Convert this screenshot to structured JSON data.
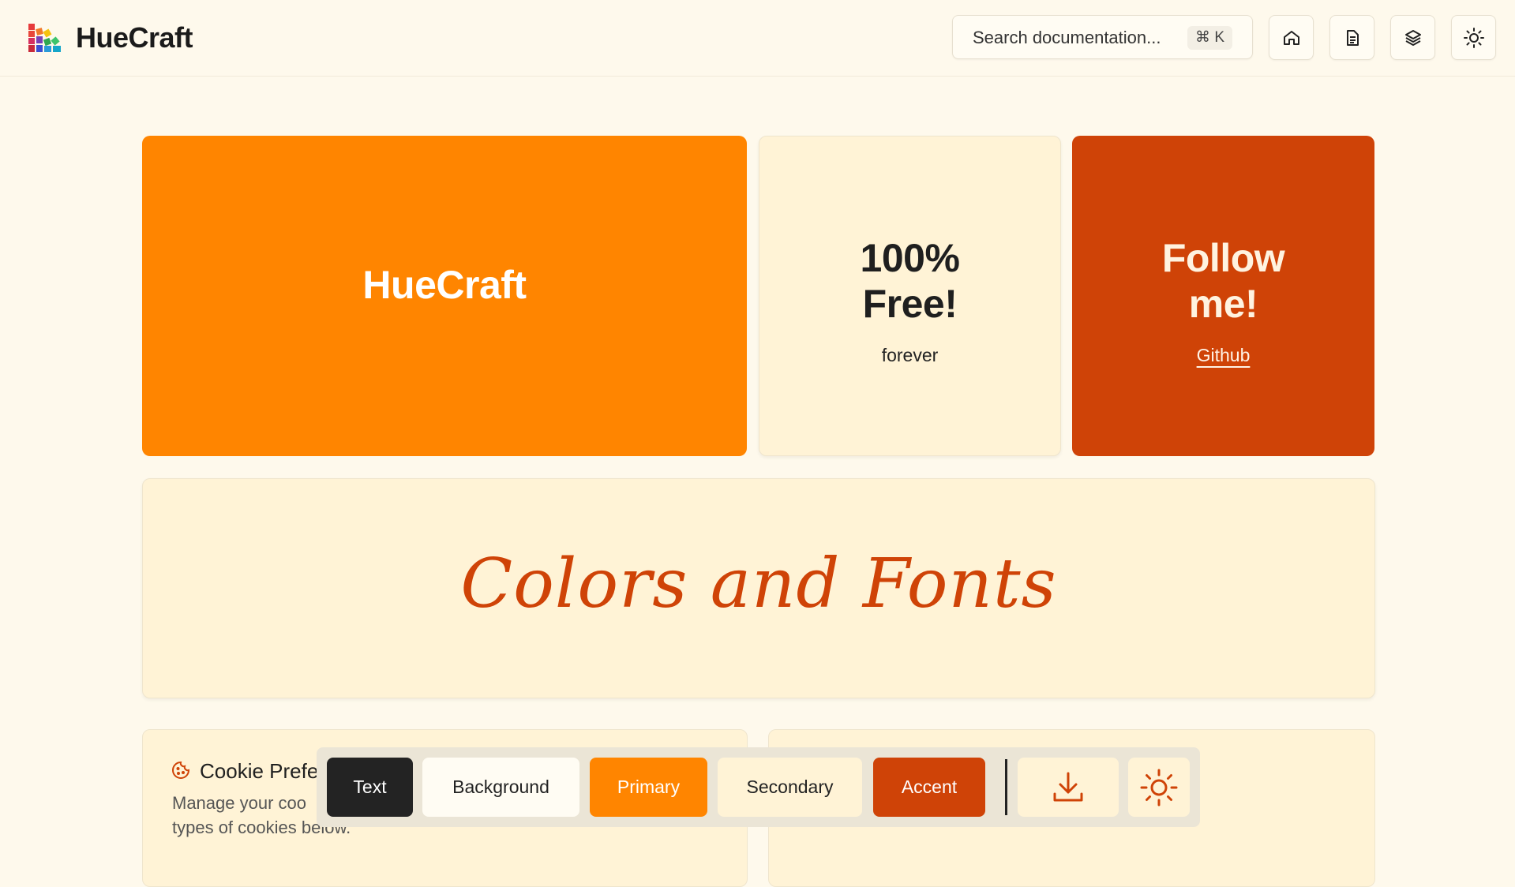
{
  "header": {
    "brand": "HueCraft",
    "search_placeholder": "Search documentation...",
    "search_shortcut": "⌘ K",
    "icons": [
      "home-icon",
      "document-icon",
      "layers-icon",
      "sun-icon"
    ]
  },
  "cards": {
    "hero_title": "HueCraft",
    "free_line1": "100%",
    "free_line2": "Free!",
    "free_sub": "forever",
    "follow_line1": "Follow",
    "follow_line2": "me!",
    "follow_link": "Github",
    "wide_title": "Colors and Fonts"
  },
  "cookie": {
    "title": "Cookie Prefe",
    "desc_line1": "Manage your coo",
    "desc_line2": "types of cookies below."
  },
  "toolbar": {
    "text_label": "Text",
    "background_label": "Background",
    "primary_label": "Primary",
    "secondary_label": "Secondary",
    "accent_label": "Accent"
  },
  "colors": {
    "background": "#fef9ec",
    "text": "#232323",
    "primary": "#ff8500",
    "secondary": "#fff3d6",
    "accent": "#cf4307"
  }
}
